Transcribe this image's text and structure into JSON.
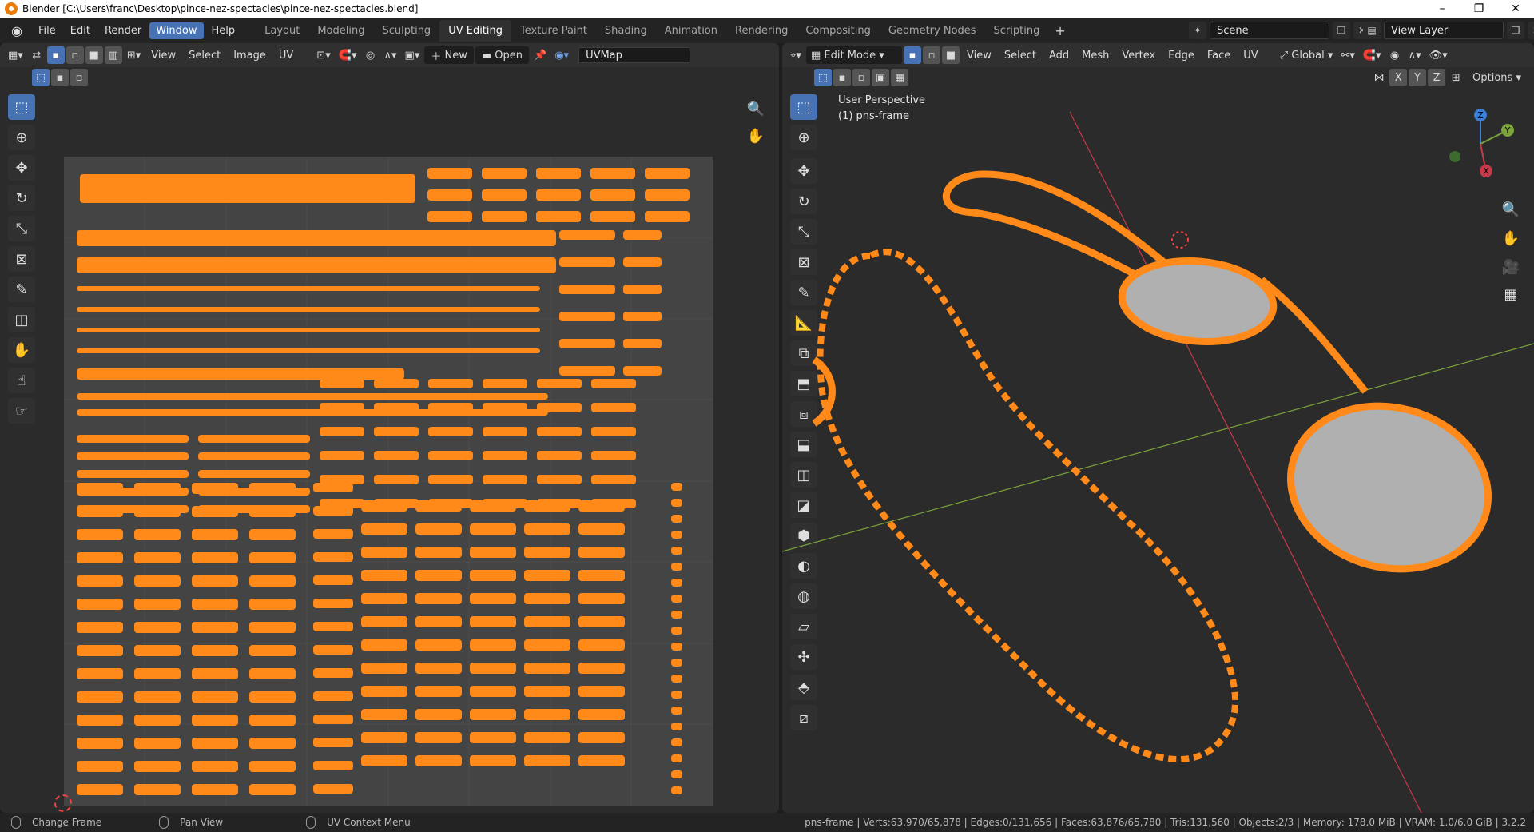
{
  "window": {
    "title": "Blender [C:\\Users\\franc\\Desktop\\pince-nez-spectacles\\pince-nez-spectacles.blend]",
    "controls": [
      "–",
      "❐",
      "✕"
    ]
  },
  "menubar": {
    "items": [
      "File",
      "Edit",
      "Render",
      "Window",
      "Help"
    ],
    "active": "Window"
  },
  "workspaces": {
    "tabs": [
      "Layout",
      "Modeling",
      "Sculpting",
      "UV Editing",
      "Texture Paint",
      "Shading",
      "Animation",
      "Rendering",
      "Compositing",
      "Geometry Nodes",
      "Scripting"
    ],
    "active": "UV Editing",
    "add": "+"
  },
  "scene": {
    "label": "Scene"
  },
  "view_layer": {
    "label": "View Layer"
  },
  "uv_editor": {
    "menus": [
      "View",
      "Select",
      "Image",
      "UV"
    ],
    "new_label": "New",
    "open_label": "Open",
    "uvmap_label": "UVMap"
  },
  "viewport": {
    "mode_label": "Edit Mode",
    "menus": [
      "View",
      "Select",
      "Add",
      "Mesh",
      "Vertex",
      "Edge",
      "Face",
      "UV"
    ],
    "orientation_label": "Global",
    "axes": [
      "X",
      "Y",
      "Z"
    ],
    "options_label": "Options",
    "overlay_title": "User Perspective",
    "overlay_object": "(1) pns-frame",
    "gizmo_axes": {
      "z": "Z",
      "y": "Y",
      "x": "X"
    }
  },
  "statusbar": {
    "change_frame": "Change Frame",
    "pan_view": "Pan View",
    "uv_context_menu": "UV Context Menu",
    "stats": "pns-frame | Verts:63,970/65,878 | Edges:0/131,656 | Faces:63,876/65,780 | Tris:131,560 | Objects:2/3 | Memory: 178.0 MiB | VRAM: 1.0/6.0 GiB | 3.2.2"
  },
  "colors": {
    "accent": "#4772b3",
    "uv_orange": "#ff8a1a",
    "lens_gray": "#b0b0b0",
    "x_axis": "#c8394a",
    "y_axis": "#7ba33a",
    "z_axis": "#3a7fd6"
  }
}
